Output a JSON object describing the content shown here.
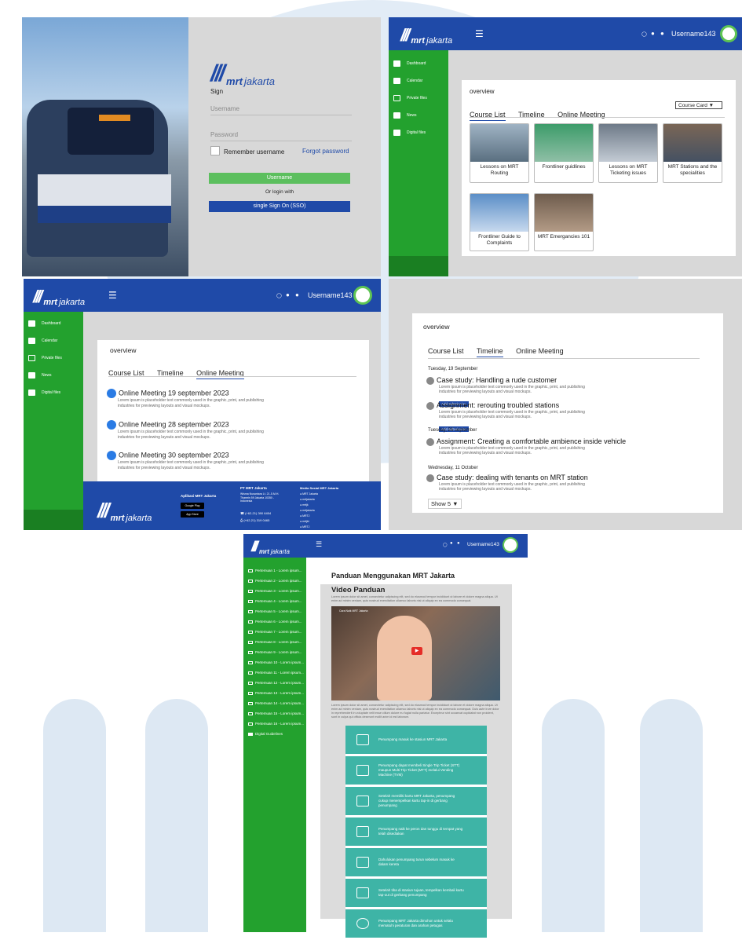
{
  "login": {
    "brand_mark": "///",
    "brand_bold": "mrt",
    "brand_light": "jakarta",
    "heading": "Sign",
    "username_placeholder": "Username",
    "password_placeholder": "Password",
    "remember_label": "Remember username",
    "forgot_label": "Forgot password",
    "submit_label": "Username",
    "or_label": "Or login with",
    "sso_label": "single Sign On (SSO)"
  },
  "header": {
    "username": "Username143"
  },
  "sidebar": {
    "items": [
      "Dashboard",
      "Calendar",
      "Private files",
      "News",
      "Digital files"
    ]
  },
  "overview": {
    "title": "overview",
    "tabs": [
      "Course List",
      "Timeline",
      "Online Meeting"
    ],
    "view_select": "Course Card",
    "courses": [
      "Lessons on MRT Routing",
      "Frontliner guidlines",
      "Lessons on MRT Ticketing issues",
      "MRT Stations and the specialities",
      "Frontliner Guide to Complaints",
      "MRT Emergancies 101"
    ]
  },
  "meetings": {
    "items": [
      "Online Meeting 19 september 2023",
      "Online Meeting 28 september 2023",
      "Online Meeting 30 september 2023"
    ],
    "desc": "Lorem ipsum is placeholder text commonly used in the graphic, print, and publishing industries for previewing layouts and visual mockups."
  },
  "footer": {
    "app_title": "Aplikasi MRT Jakarta",
    "google_play": "Google Play",
    "app_store": "App Store",
    "company": "PT MRT Jakarta",
    "socials_title": "Media Sosial MRT Jakarta",
    "address": "Wisma Nusantara Lt. 21 Jl.M.H. Thamrin 59 Jakarta 10350 - Indonesia",
    "phone": "(+62-21) 390 6454",
    "fax": "(+62-21) 319 0465",
    "socials": [
      "MRT Jakarta",
      "mrtjakarta",
      "mrtjk",
      "mrtjakarta",
      "MRTJ",
      "mrtjkt",
      "MRTJ"
    ]
  },
  "timeline": {
    "title": "overview",
    "tabs": [
      "Course List",
      "Timeline",
      "Online Meeting"
    ],
    "groups": [
      {
        "date": "Tuesday, 19 September",
        "entries": [
          {
            "title": "Case study: Handling a rude customer",
            "badge": "Add submission"
          },
          {
            "title": "Assignment: rerouting troubled stations",
            "badge": "Add submission"
          }
        ]
      },
      {
        "date": "Tuesday, 26 september",
        "entries": [
          {
            "title": "Assignment: Creating a comfortable ambience inside vehicle",
            "badge": ""
          }
        ]
      },
      {
        "date": "Wednesday, 11 October",
        "entries": [
          {
            "title": "Case study: dealing with tenants on MRT station",
            "badge": ""
          }
        ]
      }
    ],
    "desc": "Lorem ipsum is placeholder text commonly used in the graphic, print, and publishing industries for previewing layouts and visual mockups.",
    "show_label": "Show",
    "show_value": "5"
  },
  "guide": {
    "title": "Panduan Menggunakan MRT Jakarta",
    "video_title": "Video Panduan",
    "video_caption": "Cara Naik MRT Jakarta",
    "intro": "Lorem ipsum dolor sit amet, consectetur adipiscing elit, sed do eiusmod tempor incididunt ut labore et dolore magna aliqua. Ut enim ad minim veniam, quis nostrud exercitation ullamco laboris nisi ut aliquip ex ea commodo consequat.",
    "body": "Lorem ipsum dolor sit amet, consectetur adipiscing elit, sed do eiusmod tempor incididunt ut labore et dolore magna aliqua. Ut enim ad minim veniam, quis nostrud exercitation ullamco laboris nisi ut aliquip ex ea commodo consequat. Duis aute irure dolor in reprehenderit in voluptate velit esse cillum dolore eu fugiat nulla pariatur. Excepteur sint occaecat cupidatat non proident, sunt in culpa qui officia deserunt mollit anim id est laborum.",
    "steps": [
      "Penumpang masuk ke stasiun MRT Jakarta",
      "Penumpang dapat membeli Single Trip Ticket (STT) maupun Multi Trip Ticket (MTT) melalui Vending Machine (TVM)",
      "Setelah memiliki kartu MRT Jakarta, penumpang cukup menempelkan kartu tap-in di gerbang penumpang",
      "Penumpang naik ke peron dan tunggu di tempat yang telah disediakan",
      "Dahulukan penumpang turun sebelum masuk ke dalam kereta",
      "Setelah tiba di stasiun tujuan, tempelkan kembali kartu tap-out di gerbang penumpang",
      "Penumpang MRT Jakarta dimohon untuk selalu mematuhi peraturan dan arahan petugas"
    ],
    "menu": [
      "Pertemuan 1  -  Lorem ipsum...",
      "Pertemuan 2  -  Lorem ipsum...",
      "Pertemuan 3  -  Lorem ipsum...",
      "Pertemuan 4  -  Lorem ipsum...",
      "Pertemuan 5  -  Lorem ipsum...",
      "Pertemuan 6  -  Lorem ipsum...",
      "Pertemuan 7  -  Lorem ipsum...",
      "Pertemuan 8  -  Lorem ipsum...",
      "Pertemuan 9  -  Lorem ipsum...",
      "Pertemuan 10  -  Lorem ipsum...",
      "Pertemuan 11  -  Lorem ipsum...",
      "Pertemuan 12  -  Lorem ipsum...",
      "Pertemuan 13  -  Lorem ipsum...",
      "Pertemuan 14  -  Lorem ipsum...",
      "Pertemuan 15  -  Lorem ipsum...",
      "Pertemuan 16  -  Lorem ipsum..."
    ],
    "menu_last": "Digital Guidelines"
  },
  "colors": {
    "brand_blue": "#1f4aa8",
    "sidebar_green": "#23a12e",
    "teal": "#3eb4a6",
    "watermark": "#dde8f3"
  }
}
